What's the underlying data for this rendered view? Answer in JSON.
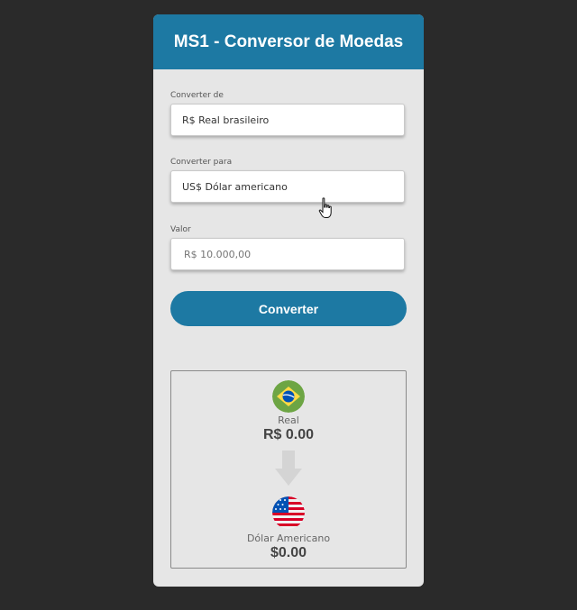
{
  "header": {
    "title": "MS1 - Conversor de Moedas"
  },
  "form": {
    "from_label": "Converter de",
    "from_value": "R$ Real brasileiro",
    "to_label": "Converter para",
    "to_value": "US$ Dólar americano",
    "amount_label": "Valor",
    "amount_placeholder": "R$ 10.000,00",
    "convert_button": "Converter"
  },
  "result": {
    "source": {
      "name": "Real",
      "value": "R$ 0.00",
      "flag_icon": "brazil-flag-icon"
    },
    "target": {
      "name": "Dólar Americano",
      "value": "$0.00",
      "flag_icon": "usa-flag-icon"
    }
  },
  "colors": {
    "accent": "#1d79a3",
    "card_bg": "#e6e6e6",
    "page_bg": "#2a2a2a"
  }
}
